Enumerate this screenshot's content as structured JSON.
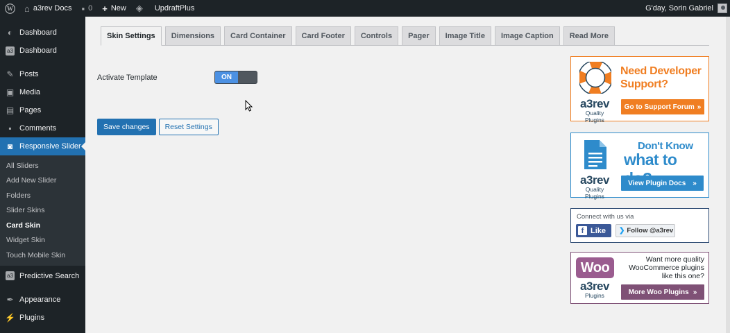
{
  "adminbar": {
    "site_name": "a3rev Docs",
    "comments_count": "0",
    "new_label": "New",
    "plugin_link": "UpdraftPlus",
    "greeting": "G'day, Sorin Gabriel"
  },
  "sidebar": {
    "items_top": [
      {
        "label": "Dashboard",
        "icon": "dashboard-icon"
      },
      {
        "label": "Dashboard",
        "icon": "a3-dashboard-icon"
      },
      {
        "label": "Posts",
        "icon": "pin-icon"
      },
      {
        "label": "Media",
        "icon": "media-icon"
      },
      {
        "label": "Pages",
        "icon": "pages-icon"
      },
      {
        "label": "Comments",
        "icon": "comments-icon"
      }
    ],
    "current": {
      "label": "Responsive Slider",
      "icon": "camera-icon"
    },
    "submenu": [
      {
        "label": "All Sliders"
      },
      {
        "label": "Add New Slider"
      },
      {
        "label": "Folders"
      },
      {
        "label": "Slider Skins"
      },
      {
        "label": "Card Skin",
        "active": true
      },
      {
        "label": "Widget Skin"
      },
      {
        "label": "Touch Mobile Skin"
      }
    ],
    "items_bottom": [
      {
        "label": "Predictive Search",
        "icon": "a3-search-icon"
      },
      {
        "label": "Appearance",
        "icon": "appearance-icon"
      },
      {
        "label": "Plugins",
        "icon": "plugins-icon"
      }
    ]
  },
  "tabs": [
    {
      "label": "Skin Settings",
      "active": true
    },
    {
      "label": "Dimensions"
    },
    {
      "label": "Card Container"
    },
    {
      "label": "Card Footer"
    },
    {
      "label": "Controls"
    },
    {
      "label": "Pager"
    },
    {
      "label": "Image Title"
    },
    {
      "label": "Image Caption"
    },
    {
      "label": "Read More"
    }
  ],
  "settings": {
    "activate_template_label": "Activate Template",
    "toggle_state": "ON"
  },
  "buttons": {
    "save": "Save changes",
    "reset": "Reset Settings"
  },
  "widgets": {
    "support": {
      "headline_line1": "Need Developer",
      "headline_line2": "Support?",
      "button": "Go to Support Forum",
      "brand": "a3rev",
      "brand_sub": "Quality Plugins",
      "accent": "#f07e22"
    },
    "docs": {
      "headline_line1": "Don't Know",
      "headline_line2": "what to do?",
      "button": "View Plugin Docs",
      "brand": "a3rev",
      "brand_sub": "Quality Plugins",
      "accent": "#2e8bcb"
    },
    "social": {
      "connect_text": "Connect with us via",
      "like_label": "Like",
      "follow_label": "Follow @a3rev"
    },
    "woo": {
      "logo_text": "Woo",
      "text_line1": "Want more quality",
      "text_line2": "WooCommerce plugins",
      "text_line3": "like this one?",
      "button": "More Woo Plugins",
      "brand": "a3rev",
      "brand_sub": "Plugins",
      "accent": "#7f5176"
    }
  }
}
